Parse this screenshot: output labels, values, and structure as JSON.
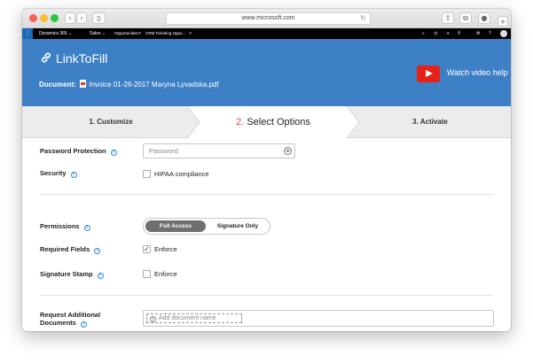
{
  "browser": {
    "url": "www.microsoft.com",
    "back_icon": "chevron-left-icon",
    "forward_icon": "chevron-right-icon",
    "sidebar_icon": "sidebar-icon",
    "reload_glyph": "↻",
    "share_glyph": "⇧",
    "tabs_glyph": "⧉",
    "new_tab_glyph": "+"
  },
  "d365": {
    "brand": "Dynamics 365",
    "module": "Sales",
    "breadcrumb_1": "Opportunities",
    "breadcrumb_2": "CRM Ticketing Oppo...",
    "nav_glyph_sep": ">",
    "chevron": "⌄"
  },
  "header": {
    "title": "LinkToFill",
    "document_label": "Document:",
    "document_name": "Invoice 01-26-2017 Maryna Lyvadska.pdf",
    "video_help": "Watch video help",
    "accent": "#3d80c6",
    "youtube_red": "#e62117"
  },
  "steps": [
    {
      "label": "1. Customize"
    },
    {
      "number": "2.",
      "label": "Select Options"
    },
    {
      "label": "3. Activate"
    }
  ],
  "form": {
    "password_protection": {
      "label": "Password Protection",
      "placeholder": "Password"
    },
    "security": {
      "label": "Security",
      "checkbox_label": "HIPAA compliance",
      "checked": false
    },
    "permissions": {
      "label": "Permissions",
      "options": [
        "Full Access",
        "Signature Only"
      ],
      "selected": "Full Access"
    },
    "required_fields": {
      "label": "Required Fields",
      "checkbox_label": "Enforce",
      "checked": true,
      "check_glyph": "✓"
    },
    "signature_stamp": {
      "label": "Signature Stamp",
      "checkbox_label": "Enforce",
      "checked": false
    },
    "request_docs": {
      "label_line1": "Request Additional",
      "label_line2": "Documents",
      "add_label": "Add document name"
    },
    "help_glyph": "?"
  }
}
